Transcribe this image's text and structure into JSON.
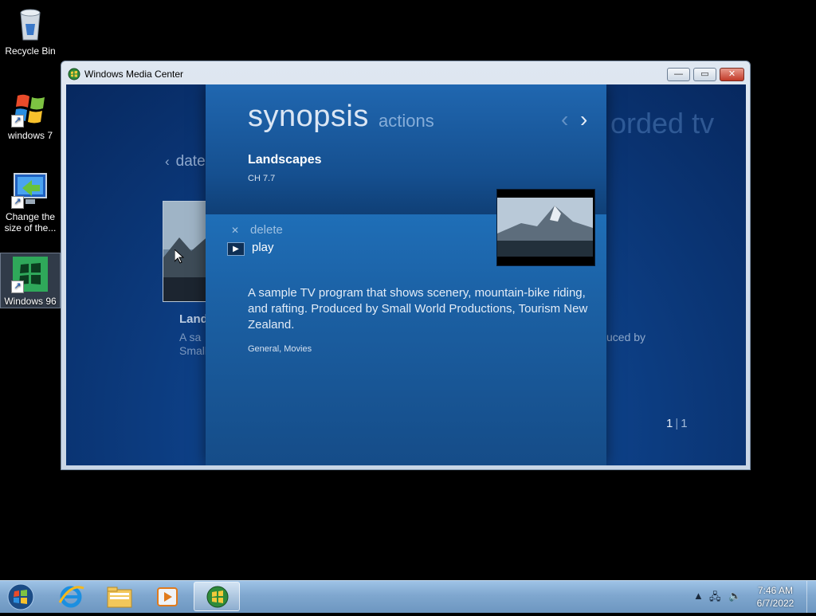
{
  "desktop": {
    "icons": [
      {
        "label": "Recycle Bin"
      },
      {
        "label": "windows 7"
      },
      {
        "label": "Change the size of the..."
      },
      {
        "label": "Windows 96"
      }
    ]
  },
  "window": {
    "title": "Windows Media Center",
    "controls": {
      "minimize": "—",
      "maximize": "▭",
      "close": "✕"
    }
  },
  "background_page": {
    "title": "orded tv",
    "back_label": "date",
    "item_name": "Land",
    "item_desc": "A sa",
    "item_desc2": "Small",
    "right_desc": "uced by",
    "page_current": "1",
    "page_total": "1"
  },
  "synopsis": {
    "tab_active": "synopsis",
    "tab_inactive": "actions",
    "program_title": "Landscapes",
    "channel": "CH 7.7",
    "actions": [
      {
        "label": "delete",
        "icon": "close-icon"
      },
      {
        "label": "play",
        "icon": "play-icon"
      }
    ],
    "description": "A sample TV program that shows scenery, mountain-bike riding, and rafting. Produced by Small World Productions, Tourism New Zealand.",
    "genres": "General, Movies"
  },
  "taskbar": {
    "pinned": [
      "start-orb",
      "internet-explorer-icon",
      "windows-explorer-icon",
      "media-player-icon",
      "media-center-icon"
    ],
    "time": "7:46 AM",
    "date": "6/7/2022"
  },
  "colors": {
    "accent": "#1b5fa2",
    "background": "#000000"
  }
}
